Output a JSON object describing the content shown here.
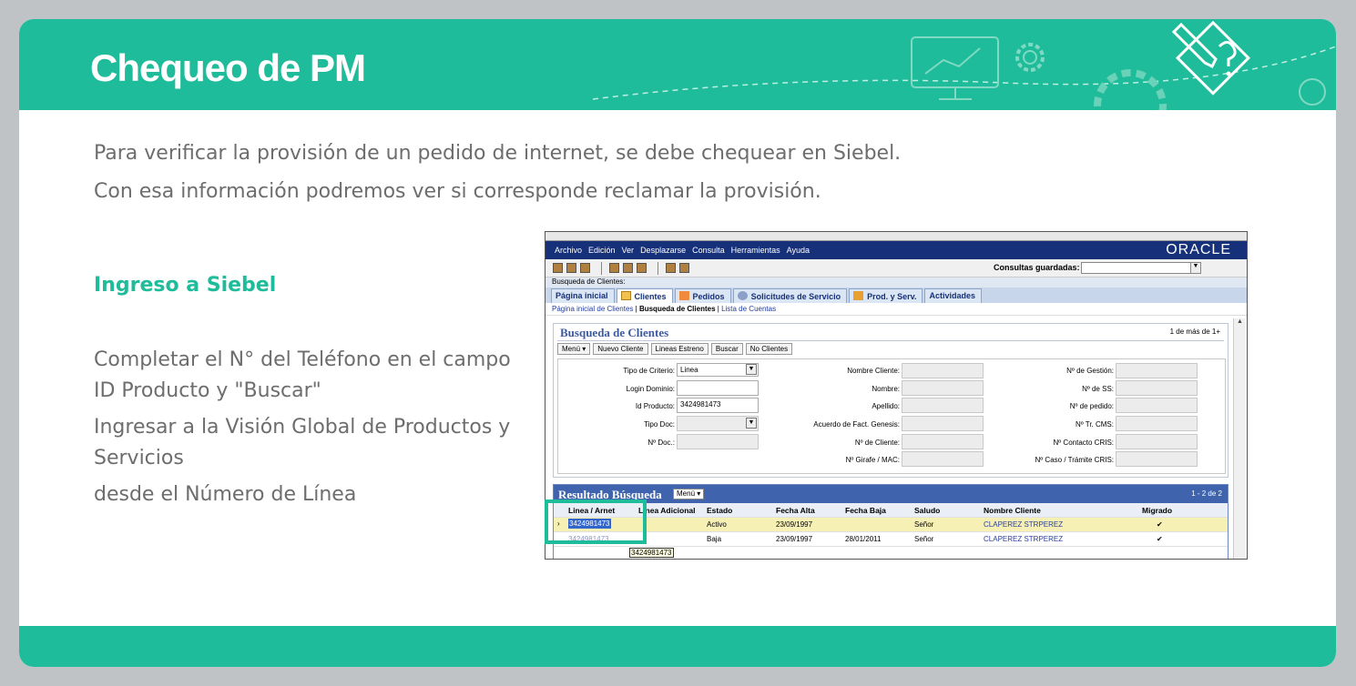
{
  "header": {
    "title": "Chequeo de PM"
  },
  "intro": [
    "Para verificar la provisión de un pedido de internet, se debe chequear en Siebel.",
    "Con esa información podremos ver si corresponde reclamar la provisión."
  ],
  "section": {
    "title": "Ingreso a Siebel"
  },
  "steps": [
    "Completar el N° del Teléfono en el campo ID Producto y \"Buscar\"",
    "Ingresar a la Visión Global de Productos y Servicios",
    "desde el Número de Línea"
  ],
  "colors": {
    "accent": "#1ebc9a",
    "siebel_blue": "#16307a"
  },
  "siebel": {
    "menu": [
      "Archivo",
      "Edición",
      "Ver",
      "Desplazarse",
      "Consulta",
      "Herramientas",
      "Ayuda"
    ],
    "brand": "ORACLE",
    "saved_queries_label": "Consultas guardadas:",
    "screen_label": "Busqueda de Clientes:",
    "tabs": [
      "Página inicial",
      "Clientes",
      "Pedidos",
      "Solicitudes de Servicio",
      "Prod. y Serv.",
      "Actividades"
    ],
    "subnav": [
      "Página inicial de Clientes",
      "Busqueda de Clientes",
      "Lista de Cuentas"
    ],
    "search": {
      "title": "Busqueda de Clientes",
      "count": "1 de más de 1+",
      "buttons": [
        "Menú ▾",
        "Nuevo Cliente",
        "Lineas Estreno",
        "Buscar",
        "No Clientes"
      ],
      "fields": {
        "tipo_criterio": {
          "label": "Tipo de Criterio:",
          "value": "Linea"
        },
        "login_dominio": {
          "label": "Login Dominio:",
          "value": ""
        },
        "id_producto": {
          "label": "Id Producto:",
          "value": "3424981473"
        },
        "tipo_doc": {
          "label": "Tipo Doc:",
          "value": ""
        },
        "nro_doc": {
          "label": "Nº Doc.:",
          "value": ""
        },
        "nombre_cliente": {
          "label": "Nombre Cliente:"
        },
        "nombre": {
          "label": "Nombre:"
        },
        "apellido": {
          "label": "Apellido:"
        },
        "acuerdo": {
          "label": "Acuerdo de Fact. Genesis:"
        },
        "nro_cliente": {
          "label": "Nº de Cliente:"
        },
        "girafe": {
          "label": "Nº Girafe / MAC:"
        },
        "gestion": {
          "label": "Nº de Gestión:"
        },
        "ss": {
          "label": "Nº de SS:"
        },
        "pedido": {
          "label": "Nº de pedido:"
        },
        "tr_cms": {
          "label": "Nº Tr. CMS:"
        },
        "contacto_cris": {
          "label": "Nº Contacto CRIS:"
        },
        "caso_cris": {
          "label": "Nº Caso / Trámite CRIS:"
        }
      }
    },
    "results": {
      "title": "Resultado Búsqueda",
      "menu": "Menú ▾",
      "count": "1 - 2 de 2",
      "columns": [
        "Linea / Arnet",
        "Linea Adicional",
        "Estado",
        "Fecha Alta",
        "Fecha Baja",
        "Saludo",
        "Nombre Cliente",
        "Migrado"
      ],
      "rows": [
        {
          "linea": "3424981473",
          "adicional": "",
          "estado": "Activo",
          "alta": "23/09/1997",
          "baja": "",
          "saludo": "Señor",
          "cliente": "CLAPEREZ STRPEREZ",
          "migrado": "✔"
        },
        {
          "linea": "3424981473",
          "adicional": "",
          "estado": "Baja",
          "alta": "23/09/1997",
          "baja": "28/01/2011",
          "saludo": "Señor",
          "cliente": "CLAPEREZ STRPEREZ",
          "migrado": "✔"
        }
      ],
      "tooltip": "3424981473"
    }
  }
}
